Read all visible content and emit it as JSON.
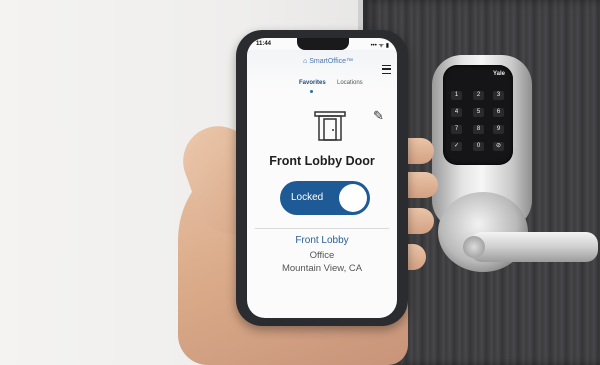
{
  "status_bar": {
    "time": "11:44",
    "icons": "••• ᯤ ▮"
  },
  "app": {
    "logo_text": "SmartOffice™",
    "logo_mark": "⌂"
  },
  "tabs": [
    {
      "label": "Favorites",
      "active": true
    },
    {
      "label": "Locations",
      "active": false
    }
  ],
  "lock_card": {
    "door_name": "Front Lobby Door",
    "toggle_label": "Locked",
    "toggle_state": "locked",
    "location_name": "Front Lobby",
    "location_type": "Office",
    "location_city": "Mountain View, CA"
  },
  "keypad": {
    "brand": "Yale",
    "keys": [
      "1",
      "2",
      "3",
      "4",
      "5",
      "6",
      "7",
      "8",
      "9",
      "0",
      "✓",
      "⊘"
    ]
  },
  "colors": {
    "accent": "#1e5b96",
    "link": "#2b5f97"
  }
}
